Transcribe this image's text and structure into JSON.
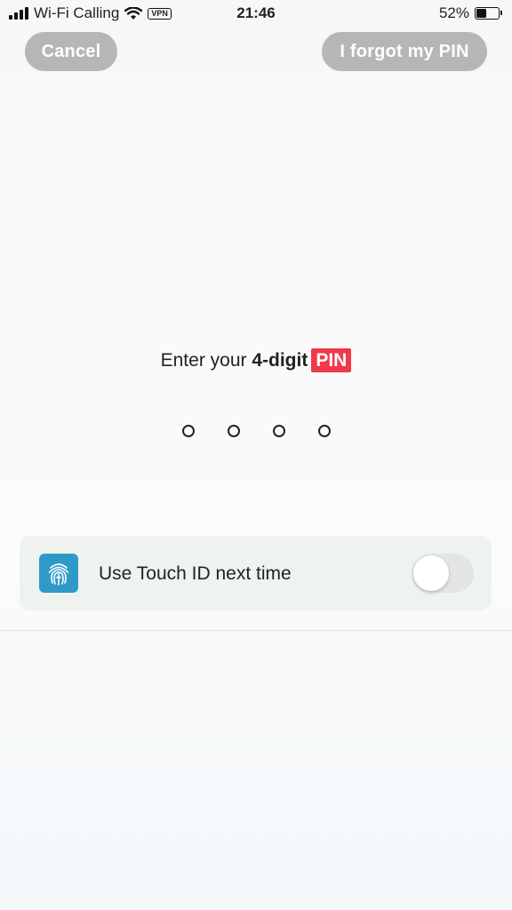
{
  "status_bar": {
    "carrier": "Wi-Fi Calling",
    "vpn": "VPN",
    "time": "21:46",
    "battery_percent": "52%",
    "battery_level": 0.52
  },
  "header": {
    "cancel_label": "Cancel",
    "forgot_label": "I forgot my PIN"
  },
  "prompt": {
    "prefix": "Enter your ",
    "emphasis": "4-digit",
    "tag": "PIN",
    "tag_color": "#f0394a"
  },
  "pin": {
    "digits": 4,
    "entered": 0
  },
  "touch_id": {
    "label": "Use Touch ID next time",
    "enabled": false,
    "icon": "fingerprint-icon",
    "icon_color": "#2f9ac8"
  }
}
